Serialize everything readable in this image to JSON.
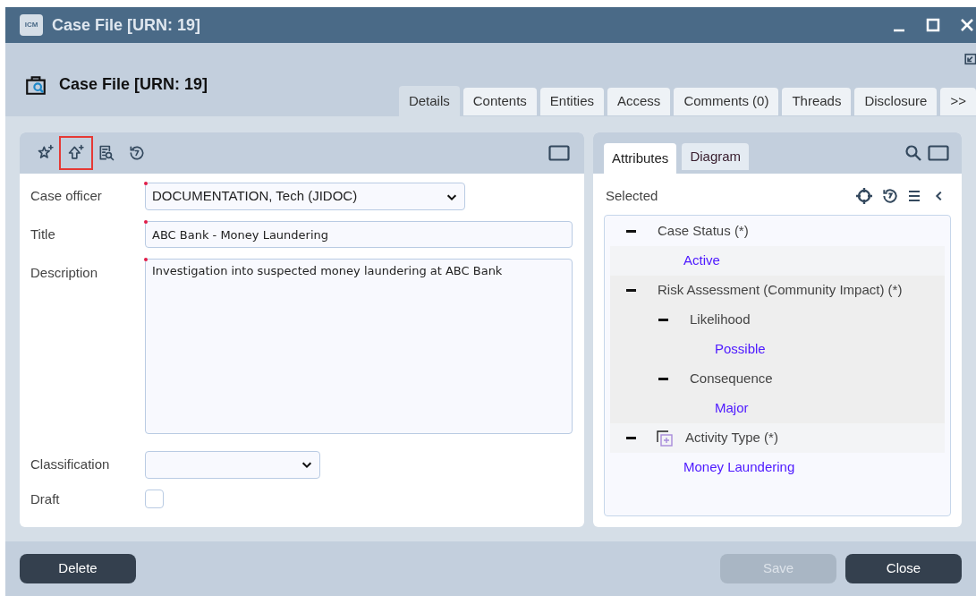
{
  "window": {
    "badge": "ICM",
    "title": "Case File [URN: 19]"
  },
  "header": {
    "title": "Case File [URN: 19]"
  },
  "tabs": [
    {
      "label": "Details",
      "selected": true
    },
    {
      "label": "Contents",
      "selected": false
    },
    {
      "label": "Entities",
      "selected": false
    },
    {
      "label": "Access",
      "selected": false
    },
    {
      "label": "Comments (0)",
      "selected": false
    },
    {
      "label": "Threads",
      "selected": false
    },
    {
      "label": "Disclosure",
      "selected": false
    },
    {
      "label": ">>",
      "selected": false
    }
  ],
  "toolbar": [
    {
      "kind": "star-plus",
      "highlighted": false
    },
    {
      "kind": "home-plus",
      "highlighted": true
    },
    {
      "kind": "doc-search",
      "highlighted": false
    },
    {
      "kind": "history",
      "highlighted": false
    }
  ],
  "form": [
    {
      "kind": "select",
      "label": "Case officer",
      "value": "DOCUMENTATION, Tech (JIDOC)",
      "required": true
    },
    {
      "kind": "text",
      "label": "Title",
      "value": "ABC Bank - Money Laundering",
      "required": true
    },
    {
      "kind": "textarea",
      "label": "Description",
      "value": "Investigation into suspected money laundering at ABC Bank",
      "required": true
    },
    {
      "kind": "select-small",
      "label": "Classification",
      "required": false
    },
    {
      "kind": "checkbox",
      "label": "Draft",
      "checked": false,
      "required": false
    }
  ],
  "side_tabs": [
    {
      "label": "Attributes",
      "selected": true
    },
    {
      "label": "Diagram",
      "selected": false
    }
  ],
  "selected_label": "Selected",
  "tree": [
    {
      "kind": "attribute",
      "label": "Case Status (*)",
      "expanded": true,
      "highlighted": false,
      "children": [
        {
          "kind": "value",
          "label": "Active"
        }
      ]
    },
    {
      "kind": "attribute",
      "label": "Risk Assessment (Community Impact) (*)",
      "expanded": true,
      "highlighted": true,
      "children": [
        {
          "kind": "attribute",
          "label": "Likelihood",
          "expanded": true,
          "children": [
            {
              "kind": "value",
              "label": "Possible"
            }
          ]
        },
        {
          "kind": "attribute",
          "label": "Consequence",
          "expanded": true,
          "children": [
            {
              "kind": "value",
              "label": "Major"
            }
          ]
        }
      ]
    },
    {
      "kind": "group",
      "label": "Activity Type (*)",
      "expanded": true,
      "highlighted": false,
      "children": [
        {
          "kind": "value-flat",
          "label": "Money Laundering"
        }
      ]
    }
  ],
  "buttons": [
    {
      "label": "Delete",
      "disabled": false
    },
    {
      "label": "Save",
      "disabled": true
    },
    {
      "label": "Close",
      "disabled": false
    }
  ]
}
